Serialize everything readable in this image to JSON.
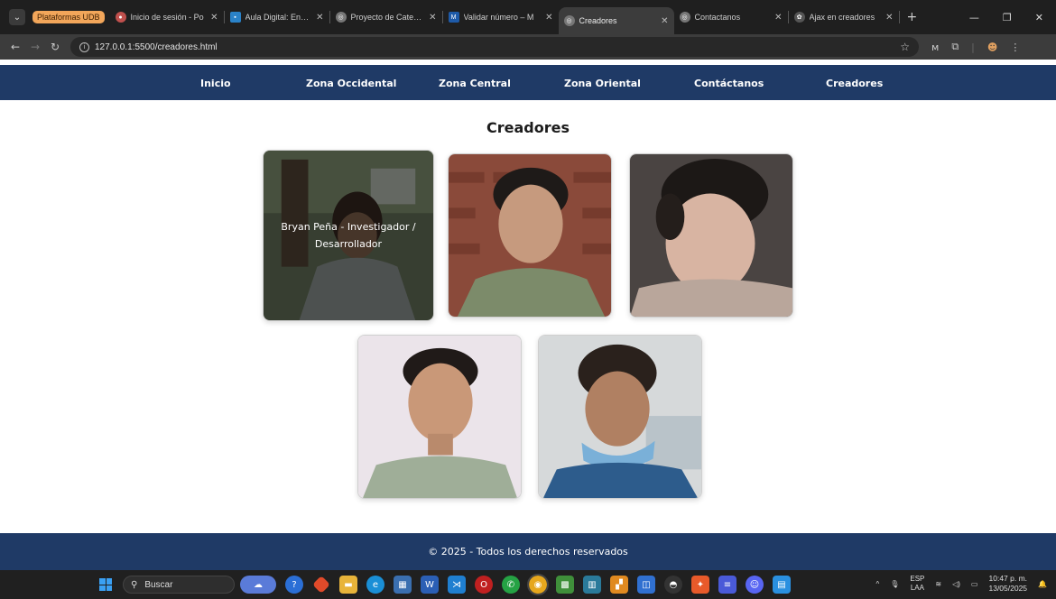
{
  "browser": {
    "tab_group_label": "Plataformas UDB",
    "tabs": [
      {
        "title": "Inicio de sesión - Po",
        "favicon": "ppt-icon"
      },
      {
        "title": "Aula Digital: Entrar",
        "favicon": "moodle-icon"
      },
      {
        "title": "Proyecto de Catedra",
        "favicon": "globe-icon"
      },
      {
        "title": "Validar número – M",
        "favicon": "m-icon"
      },
      {
        "title": "Creadores",
        "favicon": "globe-icon",
        "active": true
      },
      {
        "title": "Contactanos",
        "favicon": "globe-icon"
      },
      {
        "title": "Ajax en creadores",
        "favicon": "openai-icon"
      }
    ],
    "url": "127.0.0.1:5500/creadores.html"
  },
  "site": {
    "nav": [
      "Inicio",
      "Zona Occidental",
      "Zona Central",
      "Zona Oriental",
      "Contáctanos",
      "Creadores"
    ],
    "title": "Creadores",
    "creators": [
      {
        "caption": "Bryan Peña - Investigador / Desarrollador",
        "photo": "creator-photo-1"
      },
      {
        "caption": "",
        "photo": "creator-photo-2"
      },
      {
        "caption": "",
        "photo": "creator-photo-3"
      },
      {
        "caption": "",
        "photo": "creator-photo-4"
      },
      {
        "caption": "",
        "photo": "creator-photo-5"
      }
    ],
    "footer": "© 2025 - Todos los derechos reservados"
  },
  "taskbar": {
    "search_label": "Buscar",
    "lang_top": "ESP",
    "lang_bottom": "LAA",
    "time": "10:47 p. m.",
    "date": "13/05/2025"
  },
  "colors": {
    "nav_bg": "#1f3a66",
    "tab_group": "#f2a65a"
  }
}
